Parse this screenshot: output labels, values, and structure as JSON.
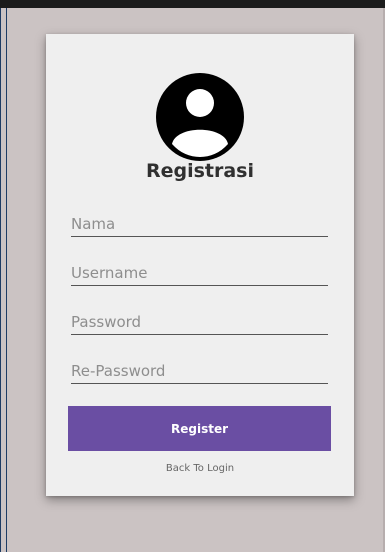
{
  "form": {
    "title": "Registrasi",
    "avatar_icon": "user-circle-icon",
    "fields": [
      {
        "name": "nama",
        "placeholder": "Nama",
        "value": ""
      },
      {
        "name": "username",
        "placeholder": "Username",
        "value": ""
      },
      {
        "name": "password",
        "placeholder": "Password",
        "value": ""
      },
      {
        "name": "re_password",
        "placeholder": "Re-Password",
        "value": ""
      }
    ],
    "register_label": "Register",
    "back_label": "Back To Login"
  },
  "colors": {
    "background": "#cbc3c3",
    "card": "#efefef",
    "accent": "#6a4ea3",
    "text": "#303030"
  }
}
